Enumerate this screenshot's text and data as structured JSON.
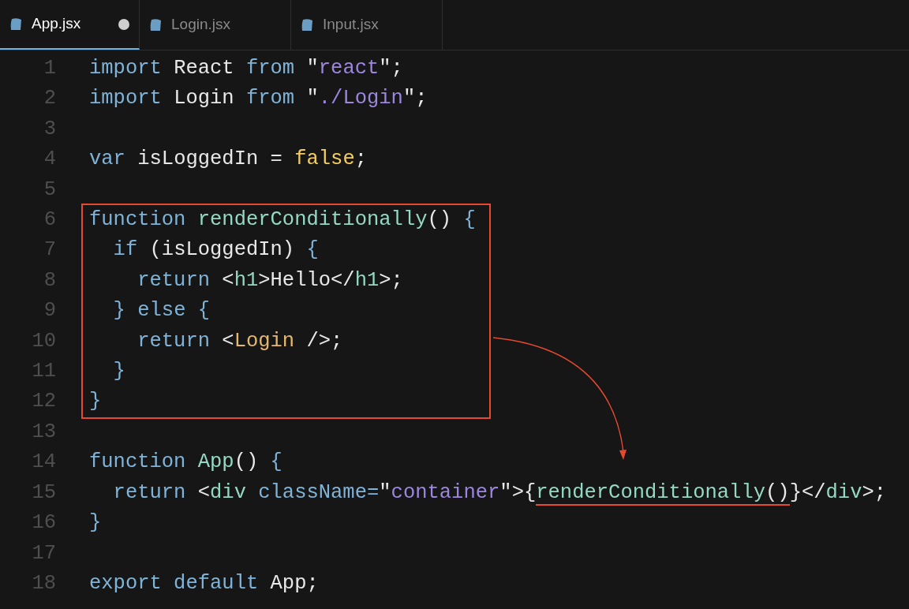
{
  "tabs": [
    {
      "label": "App.jsx",
      "selected": true,
      "modified": true
    },
    {
      "label": "Login.jsx",
      "selected": false,
      "modified": false
    },
    {
      "label": "Input.jsx",
      "selected": false,
      "modified": false
    }
  ],
  "code_blocks": [
    {
      "boxed": false,
      "lines": [
        {
          "number": "1",
          "tokens": [
            {
              "kind": "keyword",
              "text": "import"
            },
            {
              "kind": "plain",
              "text": " React "
            },
            {
              "kind": "keyword",
              "text": "from"
            },
            {
              "kind": "plain",
              "text": " \""
            },
            {
              "kind": "string",
              "text": "react"
            },
            {
              "kind": "plain",
              "text": "\";"
            }
          ]
        },
        {
          "number": "2",
          "tokens": [
            {
              "kind": "keyword",
              "text": "import"
            },
            {
              "kind": "plain",
              "text": " Login "
            },
            {
              "kind": "keyword",
              "text": "from"
            },
            {
              "kind": "plain",
              "text": " \""
            },
            {
              "kind": "string",
              "text": "./Login"
            },
            {
              "kind": "plain",
              "text": "\";"
            }
          ]
        },
        {
          "number": "3"
        },
        {
          "number": "4",
          "tokens": [
            {
              "kind": "keyword",
              "text": "var"
            },
            {
              "kind": "plain",
              "text": " isLoggedIn = "
            },
            {
              "kind": "boolean",
              "text": "false"
            },
            {
              "kind": "plain",
              "text": ";"
            }
          ]
        },
        {
          "number": "5"
        }
      ]
    },
    {
      "boxed": true,
      "lines": [
        {
          "number": "6",
          "tokens": [
            {
              "kind": "keyword",
              "text": "function "
            },
            {
              "kind": "function",
              "text": "renderConditionally"
            },
            {
              "kind": "plain",
              "text": "() "
            },
            {
              "kind": "brace",
              "text": "{"
            }
          ]
        },
        {
          "number": "7",
          "tokens": [
            {
              "kind": "keyword",
              "text": "  if"
            },
            {
              "kind": "plain",
              "text": " (isLoggedIn) "
            },
            {
              "kind": "brace",
              "text": "{"
            }
          ]
        },
        {
          "number": "8",
          "tokens": [
            {
              "kind": "keyword",
              "text": "    return"
            },
            {
              "kind": "plain",
              "text": " <"
            },
            {
              "kind": "tag",
              "text": "h1"
            },
            {
              "kind": "plain",
              "text": ">Hello</"
            },
            {
              "kind": "tag",
              "text": "h1"
            },
            {
              "kind": "plain",
              "text": ">;"
            }
          ]
        },
        {
          "number": "9",
          "tokens": [
            {
              "kind": "brace",
              "text": "  } "
            },
            {
              "kind": "keyword",
              "text": "else "
            },
            {
              "kind": "brace",
              "text": "{"
            }
          ]
        },
        {
          "number": "10",
          "tokens": [
            {
              "kind": "keyword",
              "text": "    return"
            },
            {
              "kind": "plain",
              "text": " <"
            },
            {
              "kind": "component",
              "text": "Login"
            },
            {
              "kind": "plain",
              "text": " />;"
            }
          ]
        },
        {
          "number": "11",
          "tokens": [
            {
              "kind": "brace",
              "text": "  }"
            }
          ]
        },
        {
          "number": "12",
          "tokens": [
            {
              "kind": "brace",
              "text": "}"
            }
          ]
        }
      ]
    },
    {
      "boxed": false,
      "lines": [
        {
          "number": "13"
        },
        {
          "number": "14",
          "tokens": [
            {
              "kind": "keyword",
              "text": "function "
            },
            {
              "kind": "function",
              "text": "App"
            },
            {
              "kind": "plain",
              "text": "() "
            },
            {
              "kind": "brace",
              "text": "{"
            }
          ]
        },
        {
          "number": "15",
          "tokens": [
            {
              "kind": "keyword",
              "text": "  return"
            },
            {
              "kind": "plain",
              "text": " <"
            },
            {
              "kind": "tag",
              "text": "div"
            },
            {
              "kind": "attribute",
              "text": " className"
            },
            {
              "kind": "keyword",
              "text": "="
            },
            {
              "kind": "plain",
              "text": "\""
            },
            {
              "kind": "string",
              "text": "container"
            },
            {
              "kind": "plain",
              "text": "\">{"
            },
            {
              "kind": "function",
              "text": "renderConditionally",
              "underlined": true
            },
            {
              "kind": "plain",
              "text": "()",
              "underlined": true
            },
            {
              "kind": "plain",
              "text": "}</"
            },
            {
              "kind": "tag",
              "text": "div"
            },
            {
              "kind": "plain",
              "text": ">;"
            }
          ]
        },
        {
          "number": "16",
          "tokens": [
            {
              "kind": "brace",
              "text": "}"
            }
          ]
        },
        {
          "number": "17"
        },
        {
          "number": "18",
          "tokens": [
            {
              "kind": "keyword",
              "text": "export default"
            },
            {
              "kind": "plain",
              "text": " App;"
            }
          ]
        }
      ]
    }
  ]
}
